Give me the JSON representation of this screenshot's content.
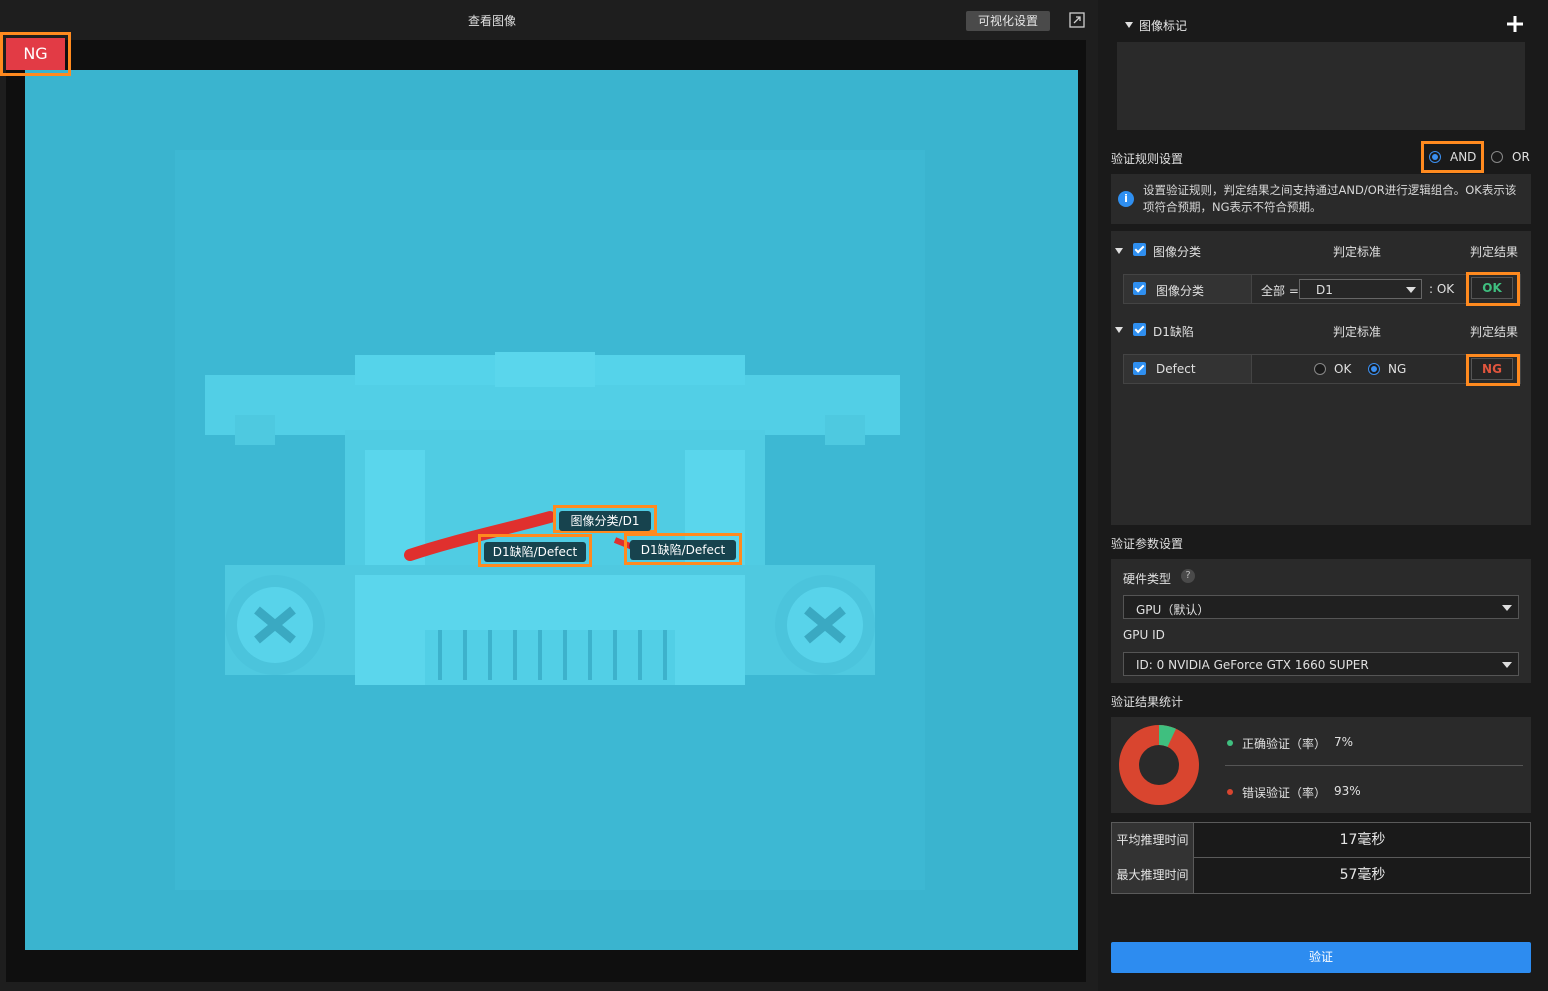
{
  "viewer": {
    "title": "查看图像",
    "vis_button": "可视化设置",
    "result_badge": "NG",
    "tags": [
      "图像分类/D1",
      "D1缺陷/Defect",
      "D1缺陷/Defect"
    ]
  },
  "mark": {
    "title": "图像标记"
  },
  "rules": {
    "title": "验证规则设置",
    "and_label": "AND",
    "or_label": "OR",
    "info": "设置验证规则，判定结果之间支持通过AND/OR进行逻辑组合。OK表示该项符合预期，NG表示不符合预期。",
    "groups": [
      {
        "name": "图像分类",
        "criteria_header": "判定标准",
        "result_header": "判定结果",
        "row_name": "图像分类",
        "all_label": "全部 =",
        "dropdown_value": "D1",
        "ok_suffix": ": OK",
        "result": "OK"
      },
      {
        "name": "D1缺陷",
        "criteria_header": "判定标准",
        "result_header": "判定结果",
        "row_name": "Defect",
        "opt_ok": "OK",
        "opt_ng": "NG",
        "result": "NG"
      }
    ]
  },
  "params": {
    "title": "验证参数设置",
    "hw_label": "硬件类型",
    "hw_value": "GPU（默认）",
    "gpu_label": "GPU ID",
    "gpu_value": "ID: 0  NVIDIA GeForce GTX 1660 SUPER"
  },
  "stats": {
    "title": "验证结果统计",
    "correct_label": "正确验证（率）",
    "correct_value": "7%",
    "wrong_label": "错误验证（率）",
    "wrong_value": "93%",
    "correct_fraction": 0.07,
    "colors": {
      "correct": "#3fbf7f",
      "wrong": "#d9452f"
    }
  },
  "timing": {
    "avg_label": "平均推理时间",
    "avg_value": "17毫秒",
    "max_label": "最大推理时间",
    "max_value": "57毫秒"
  },
  "verify_button": "验证",
  "colors": {
    "accent": "#2d8cf0",
    "ok": "#3fbf7f",
    "ng": "#e0553d",
    "highlight": "#ff8a1f"
  }
}
